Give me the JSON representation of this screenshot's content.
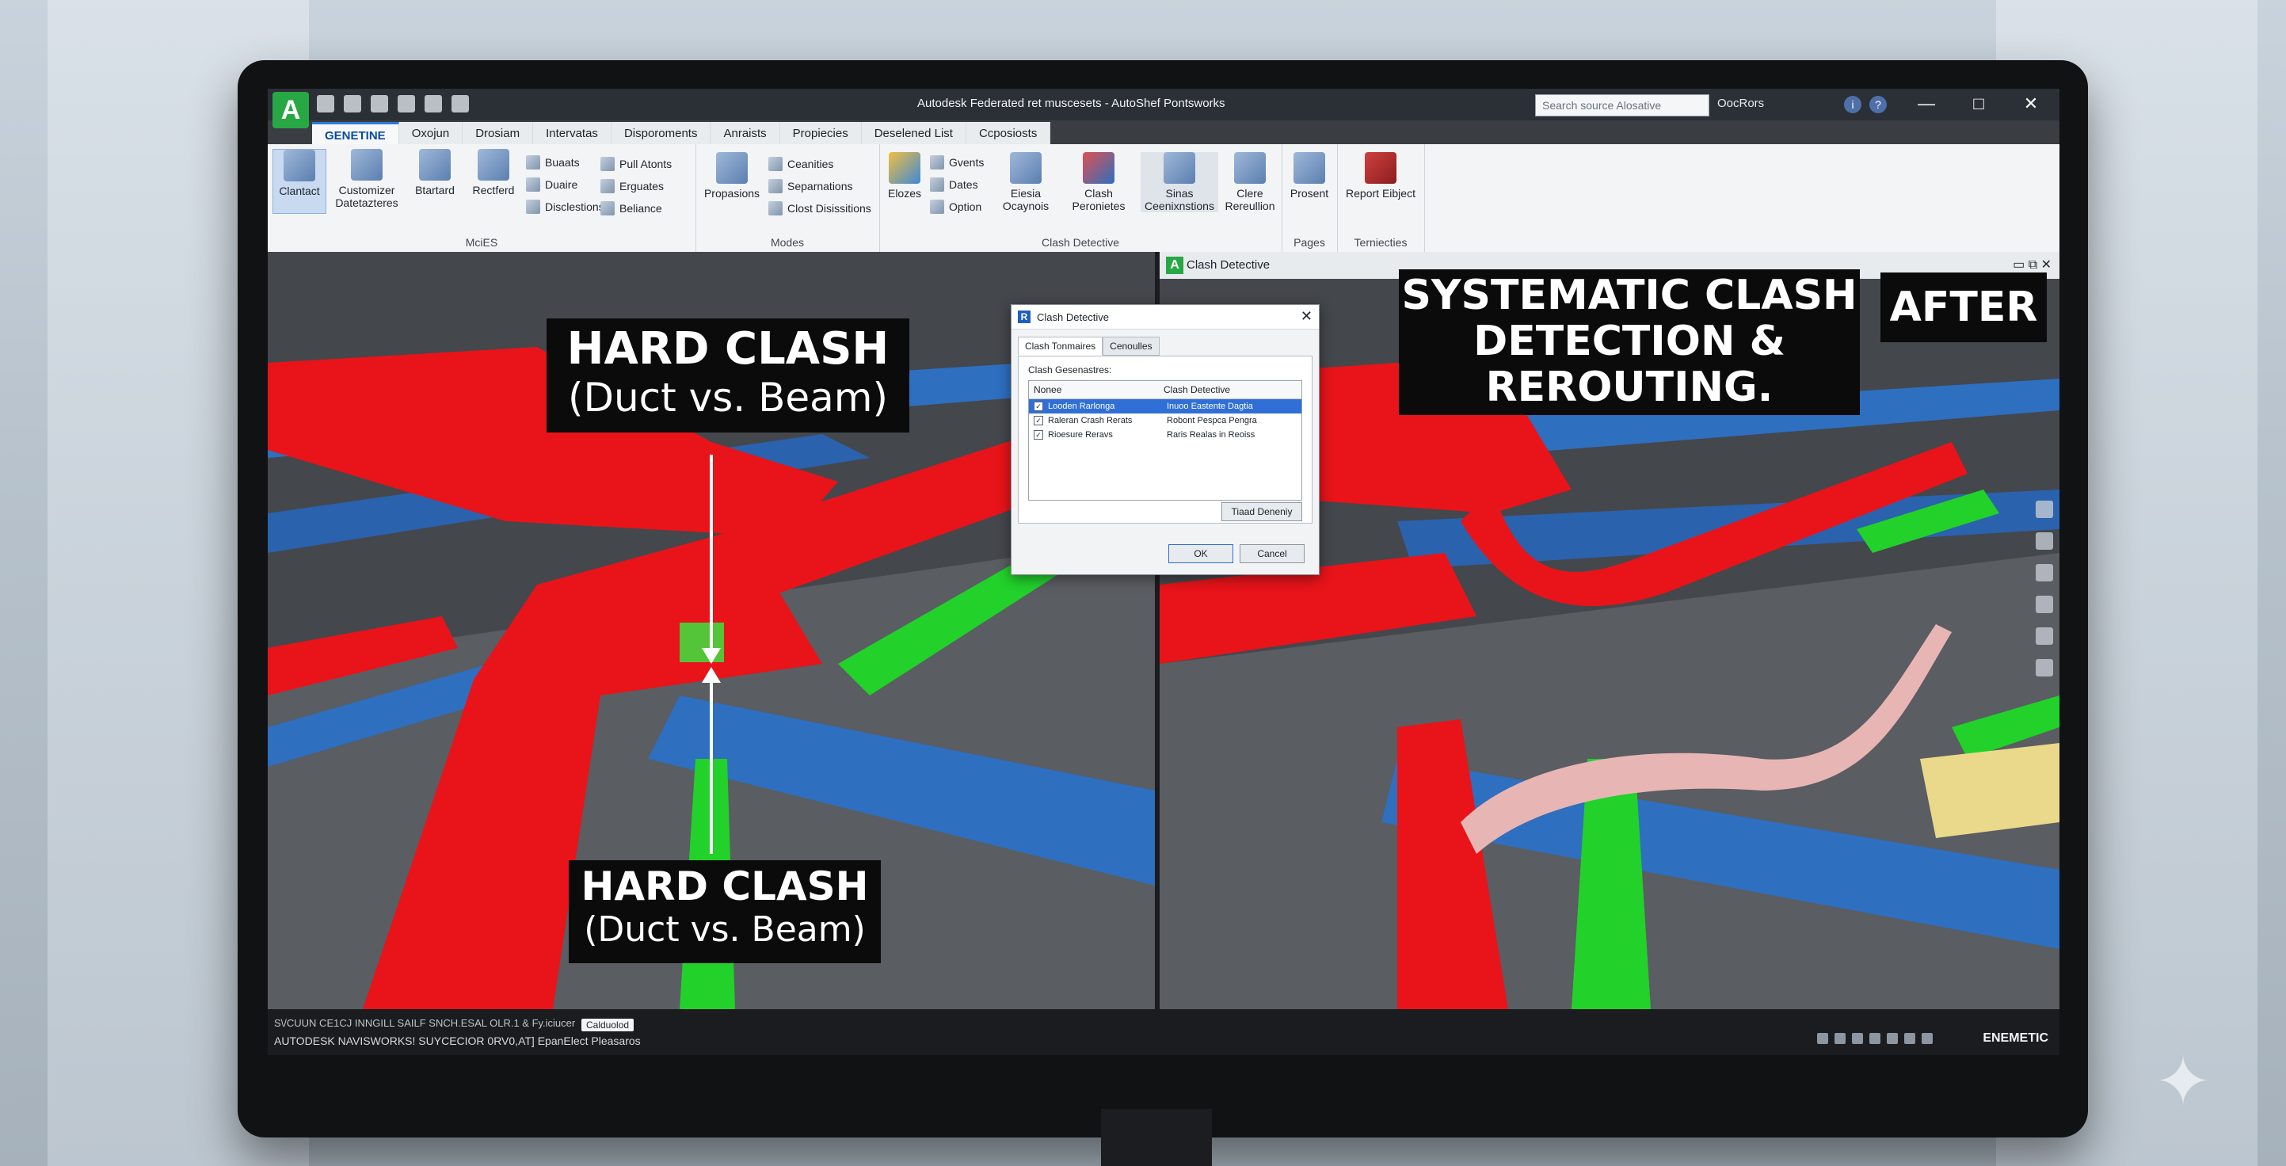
{
  "window": {
    "title": "Autodesk Federated ret muscesets - AutoShef Pontsworks",
    "search_placeholder": "Search source Alosative",
    "user": "OocRors",
    "controls": [
      "—",
      "□",
      "✕"
    ]
  },
  "ribbon": {
    "tabs": [
      "GENETINE",
      "Oxojun",
      "Drosiam",
      "Intervatas",
      "Disporoments",
      "Anraists",
      "Propiecies",
      "Deselened List",
      "Ccposiosts"
    ],
    "active_tab_index": 0,
    "groups": {
      "group1_label": "MciES",
      "group2_label": "Modes",
      "group3_label": "Clash Detective",
      "group4_label": "Pages",
      "group5_label": "Terniecties"
    },
    "buttons": {
      "clantact": "Clantact",
      "customizer": "Customizer Datetazteres",
      "btartard": "Btartard",
      "rectferd": "Rectferd",
      "buaats": "Buaats",
      "duaire": "Duaire",
      "disclestions": "Disclestions",
      "pull_atonts": "Pull Atonts",
      "erguates": "Erguates",
      "beliance": "Beliance",
      "propasions": "Propasions",
      "ceanities": "Ceanities",
      "separnations": "Separnations",
      "clost_disissitions": "Clost Disissitions",
      "elozes": "Elozes",
      "gvents": "Gvents",
      "dates": "Dates",
      "option": "Option",
      "eiesia_ocaynois": "Eiesia Ocaynois",
      "clash_peronietes": "Clash Peronietes",
      "sinas_ceenixnstions": "Sinas Ceenixnstions",
      "clere_rereullion": "Clere Rereullion",
      "prosent": "Prosent",
      "report_eibject": "Report Eibject"
    }
  },
  "viewport_right": {
    "title": "Clash Detective",
    "controls": "▭ ⧉ ✕"
  },
  "labels": {
    "top_left_title": "HARD CLASH",
    "top_left_sub": "(Duct vs. Beam)",
    "bottom_left_title": "HARD CLASH",
    "bottom_left_sub": "(Duct vs. Beam)",
    "right_title_line1": "SYSTEMATIC CLASH",
    "right_title_line2": "DETECTION &",
    "right_title_line3": "REROUTING.",
    "after": "AFTER"
  },
  "dialog": {
    "title": "Clash Detective",
    "close": "✕",
    "tabs": [
      "Clash Tonmaires",
      "Cenoulles"
    ],
    "caption": "Clash Gesenastres:",
    "columns": [
      "Nonee",
      "Clash Detective"
    ],
    "rows": [
      {
        "name": "Looden Rarlonga",
        "value": "Inuoo Eastente Dagtia",
        "checked": true,
        "selected": true
      },
      {
        "name": "Raleran Crash Rerats",
        "value": "Robont Pespca Pengra",
        "checked": true,
        "selected": false
      },
      {
        "name": "Rioesure Reravs",
        "value": "Raris Realas in Reoiss",
        "checked": true,
        "selected": false
      }
    ],
    "action_button": "Tiaad Deneniy",
    "ok": "OK",
    "cancel": "Cancel"
  },
  "statusbar": {
    "left": "AUTODESK NAVISWORKS! SUYCECIOR 0RV0,AT] EpanElect Pleasaros",
    "mid": "S\\/CUUN CE1CJ INNGILL SAILF SNCH.ESAL OLR.1 & Fy.iciucer",
    "badge": "Calduolod",
    "right": "ENEMETIC"
  },
  "colors": {
    "duct_red": "#e8141a",
    "beam_blue": "#2e6fc0",
    "pipe_green": "#22d12a",
    "reroute_pink": "#e7b6b4",
    "accent": "#2b7bd6"
  }
}
